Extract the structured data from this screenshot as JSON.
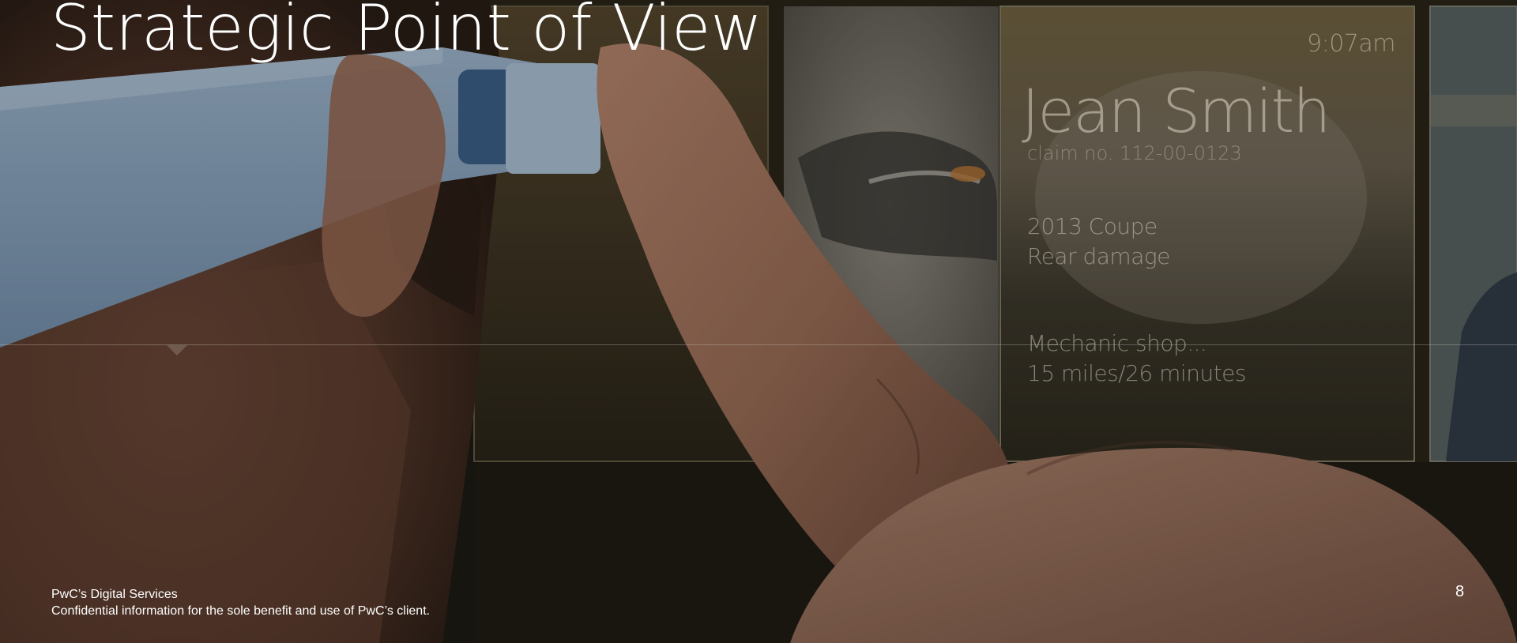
{
  "slide": {
    "title": "Strategic Point of View",
    "page_number": "8"
  },
  "footer": {
    "line1": "PwC’s Digital Services",
    "line2": "Confidential information for the sole benefit and use of PwC’s client."
  },
  "glass_card": {
    "time": "9:07am",
    "name": "Jean Smith",
    "claim": "claim no. 112-00-0123",
    "vehicle": "2013 Coupe",
    "damage": "Rear damage",
    "shop": "Mechanic shop...",
    "distance": "15 miles/26 minutes"
  },
  "colors": {
    "title_text": "#ffffff",
    "background": "#1a1712",
    "glasses_blue": "#9db9d6"
  }
}
